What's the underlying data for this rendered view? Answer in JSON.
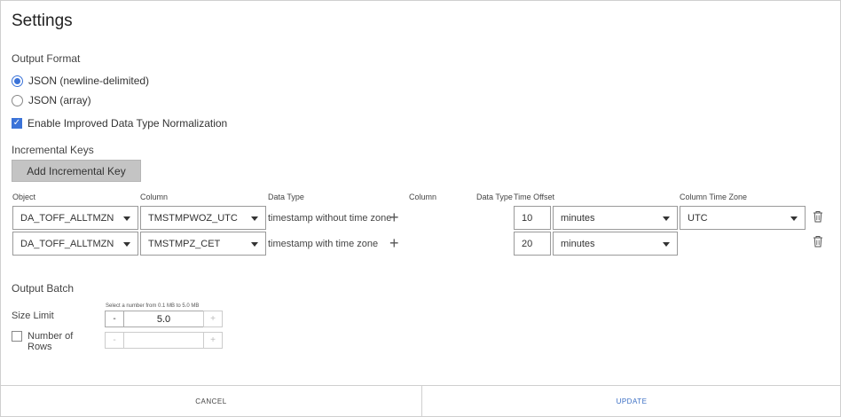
{
  "dialog": {
    "title": "Settings"
  },
  "output_format": {
    "label": "Output Format",
    "options": [
      {
        "label": "JSON (newline-delimited)",
        "selected": true
      },
      {
        "label": "JSON (array)",
        "selected": false
      }
    ],
    "normalization": {
      "label": "Enable Improved Data Type Normalization",
      "checked": true
    }
  },
  "incremental_keys": {
    "label": "Incremental Keys",
    "add_label": "Add Incremental Key",
    "headers": {
      "object": "Object",
      "column": "Column",
      "data_type": "Data Type",
      "column2": "Column",
      "data_type2": "Data Type",
      "time_offset": "Time Offset",
      "column_time_zone": "Column Time Zone"
    },
    "rows": [
      {
        "object": "DA_TOFF_ALLTMZN",
        "column": "TMSTMPWOZ_UTC",
        "data_type": "timestamp without time zone",
        "offset": "10",
        "unit": "minutes",
        "time_zone": "UTC"
      },
      {
        "object": "DA_TOFF_ALLTMZN",
        "column": "TMSTMPZ_CET",
        "data_type": "timestamp with time zone",
        "offset": "20",
        "unit": "minutes",
        "time_zone": ""
      }
    ]
  },
  "output_batch": {
    "label": "Output Batch",
    "size_limit": {
      "label": "Size Limit",
      "hint": "Select a number from 0.1 MB to 5.0 MB",
      "value": "5.0",
      "minus": "-",
      "plus": "+"
    },
    "rows": {
      "label_line1": "Number of",
      "label_line2": "Rows",
      "checked": false,
      "value": "",
      "minus": "-",
      "plus": "+"
    }
  },
  "footer": {
    "cancel": "CANCEL",
    "update": "UPDATE"
  },
  "colors": {
    "accent": "#3b73d8",
    "update_text": "#3b6fc4"
  }
}
